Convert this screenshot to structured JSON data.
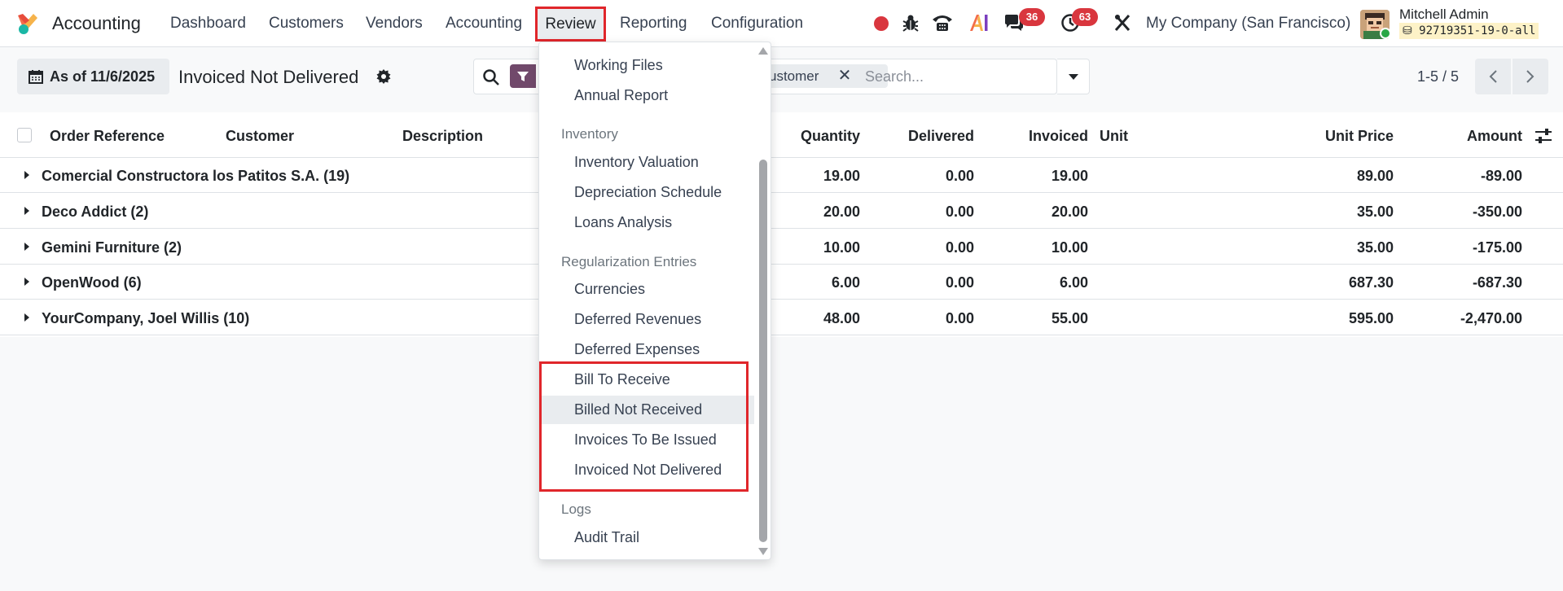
{
  "app": {
    "name": "Accounting",
    "logo_icon": "odoo-accounting-logo-icon"
  },
  "nav": {
    "items": [
      "Dashboard",
      "Customers",
      "Vendors",
      "Accounting",
      "Review",
      "Reporting",
      "Configuration"
    ],
    "active": "Review"
  },
  "systray": {
    "messages_count": "36",
    "activities_count": "63",
    "company": "My Company (San Francisco)",
    "user_name": "Mitchell Admin",
    "database": "92719351-19-0-all"
  },
  "control": {
    "date_button": "As of 11/6/2025",
    "title": "Invoiced Not Delivered",
    "facet_label": "ustomer",
    "search_placeholder": "Search...",
    "pager": "1-5 / 5"
  },
  "table": {
    "columns": [
      "Order Reference",
      "Customer",
      "Description",
      "Quantity",
      "Delivered",
      "Invoiced",
      "Unit",
      "Unit Price",
      "Amount"
    ],
    "groups": [
      {
        "name": "Comercial Constructora los Patitos S.A. (19)",
        "quantity": "19.00",
        "delivered": "0.00",
        "invoiced": "19.00",
        "unit_price": "89.00",
        "amount": "-89.00"
      },
      {
        "name": "Deco Addict (2)",
        "quantity": "20.00",
        "delivered": "0.00",
        "invoiced": "20.00",
        "unit_price": "35.00",
        "amount": "-350.00"
      },
      {
        "name": "Gemini Furniture (2)",
        "quantity": "10.00",
        "delivered": "0.00",
        "invoiced": "10.00",
        "unit_price": "35.00",
        "amount": "-175.00"
      },
      {
        "name": "OpenWood (6)",
        "quantity": "6.00",
        "delivered": "0.00",
        "invoiced": "6.00",
        "unit_price": "687.30",
        "amount": "-687.30"
      },
      {
        "name": "YourCompany, Joel Willis (10)",
        "quantity": "48.00",
        "delivered": "0.00",
        "invoiced": "55.00",
        "unit_price": "595.00",
        "amount": "-2,470.00"
      }
    ]
  },
  "dropdown": {
    "items_top": [
      "Working Files",
      "Annual Report"
    ],
    "sections": [
      {
        "title": "Inventory",
        "items": [
          "Inventory Valuation",
          "Depreciation Schedule",
          "Loans Analysis"
        ]
      },
      {
        "title": "Regularization Entries",
        "items": [
          "Currencies",
          "Deferred Revenues",
          "Deferred Expenses",
          "Bill To Receive",
          "Billed Not Received",
          "Invoices To Be Issued",
          "Invoiced Not Delivered"
        ]
      },
      {
        "title": "Logs",
        "items": [
          "Audit Trail"
        ]
      }
    ],
    "hovered": "Billed Not Received"
  },
  "colors": {
    "accent": "#71496b",
    "badge": "#d9363e",
    "highlight": "#e0262b"
  }
}
